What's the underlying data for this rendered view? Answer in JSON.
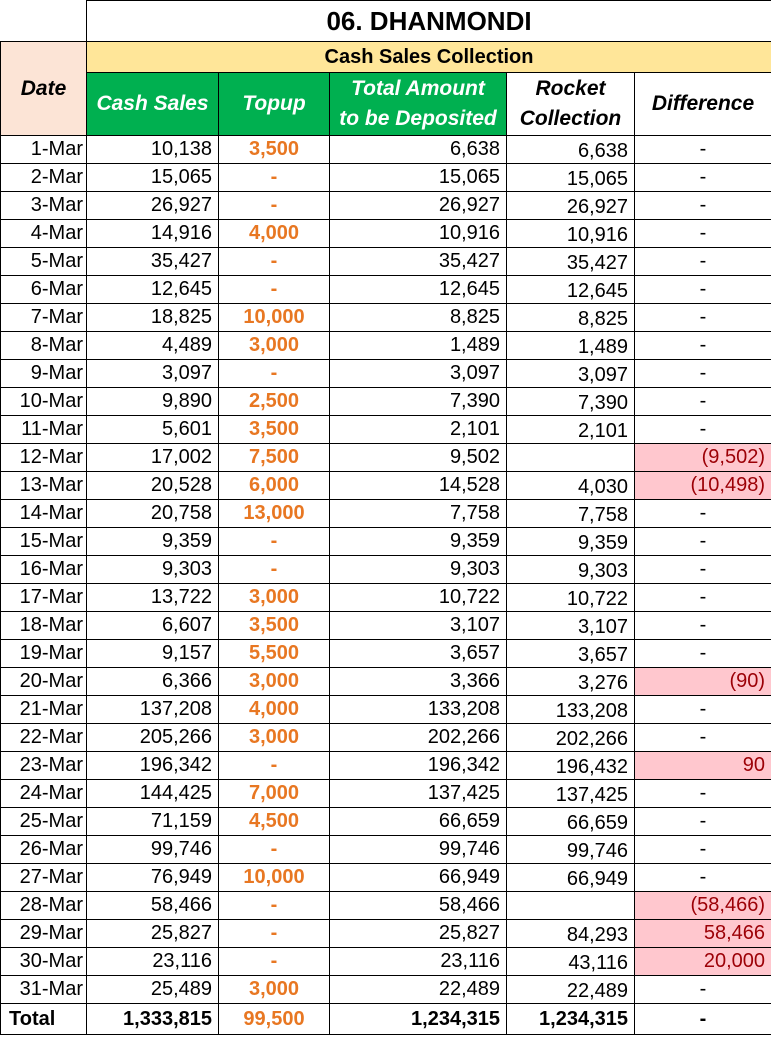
{
  "title": "06. DHANMONDI",
  "subheader": "Cash Sales Collection",
  "headers": {
    "date": "Date",
    "cash_sales": "Cash Sales",
    "topup": "Topup",
    "total_line1": "Total Amount",
    "total_line2": "to be Deposited",
    "rocket_line1": "Rocket",
    "rocket_line2": "Collection",
    "difference": "Difference"
  },
  "rows": [
    {
      "date": "1-Mar",
      "cash": "10,138",
      "topup": "3,500",
      "total": "6,638",
      "rocket": "6,638",
      "diff": "-",
      "flag": false
    },
    {
      "date": "2-Mar",
      "cash": "15,065",
      "topup": "-",
      "total": "15,065",
      "rocket": "15,065",
      "diff": "-",
      "flag": false
    },
    {
      "date": "3-Mar",
      "cash": "26,927",
      "topup": "-",
      "total": "26,927",
      "rocket": "26,927",
      "diff": "-",
      "flag": false
    },
    {
      "date": "4-Mar",
      "cash": "14,916",
      "topup": "4,000",
      "total": "10,916",
      "rocket": "10,916",
      "diff": "-",
      "flag": false
    },
    {
      "date": "5-Mar",
      "cash": "35,427",
      "topup": "-",
      "total": "35,427",
      "rocket": "35,427",
      "diff": "-",
      "flag": false
    },
    {
      "date": "6-Mar",
      "cash": "12,645",
      "topup": "-",
      "total": "12,645",
      "rocket": "12,645",
      "diff": "-",
      "flag": false
    },
    {
      "date": "7-Mar",
      "cash": "18,825",
      "topup": "10,000",
      "total": "8,825",
      "rocket": "8,825",
      "diff": "-",
      "flag": false
    },
    {
      "date": "8-Mar",
      "cash": "4,489",
      "topup": "3,000",
      "total": "1,489",
      "rocket": "1,489",
      "diff": "-",
      "flag": false
    },
    {
      "date": "9-Mar",
      "cash": "3,097",
      "topup": "-",
      "total": "3,097",
      "rocket": "3,097",
      "diff": "-",
      "flag": false
    },
    {
      "date": "10-Mar",
      "cash": "9,890",
      "topup": "2,500",
      "total": "7,390",
      "rocket": "7,390",
      "diff": "-",
      "flag": false
    },
    {
      "date": "11-Mar",
      "cash": "5,601",
      "topup": "3,500",
      "total": "2,101",
      "rocket": "2,101",
      "diff": "-",
      "flag": false
    },
    {
      "date": "12-Mar",
      "cash": "17,002",
      "topup": "7,500",
      "total": "9,502",
      "rocket": "",
      "diff": "(9,502)",
      "flag": true
    },
    {
      "date": "13-Mar",
      "cash": "20,528",
      "topup": "6,000",
      "total": "14,528",
      "rocket": "4,030",
      "diff": "(10,498)",
      "flag": true
    },
    {
      "date": "14-Mar",
      "cash": "20,758",
      "topup": "13,000",
      "total": "7,758",
      "rocket": "7,758",
      "diff": "-",
      "flag": false
    },
    {
      "date": "15-Mar",
      "cash": "9,359",
      "topup": "-",
      "total": "9,359",
      "rocket": "9,359",
      "diff": "-",
      "flag": false
    },
    {
      "date": "16-Mar",
      "cash": "9,303",
      "topup": "-",
      "total": "9,303",
      "rocket": "9,303",
      "diff": "-",
      "flag": false
    },
    {
      "date": "17-Mar",
      "cash": "13,722",
      "topup": "3,000",
      "total": "10,722",
      "rocket": "10,722",
      "diff": "-",
      "flag": false
    },
    {
      "date": "18-Mar",
      "cash": "6,607",
      "topup": "3,500",
      "total": "3,107",
      "rocket": "3,107",
      "diff": "-",
      "flag": false
    },
    {
      "date": "19-Mar",
      "cash": "9,157",
      "topup": "5,500",
      "total": "3,657",
      "rocket": "3,657",
      "diff": "-",
      "flag": false
    },
    {
      "date": "20-Mar",
      "cash": "6,366",
      "topup": "3,000",
      "total": "3,366",
      "rocket": "3,276",
      "diff": "(90)",
      "flag": true
    },
    {
      "date": "21-Mar",
      "cash": "137,208",
      "topup": "4,000",
      "total": "133,208",
      "rocket": "133,208",
      "diff": "-",
      "flag": false
    },
    {
      "date": "22-Mar",
      "cash": "205,266",
      "topup": "3,000",
      "total": "202,266",
      "rocket": "202,266",
      "diff": "-",
      "flag": false
    },
    {
      "date": "23-Mar",
      "cash": "196,342",
      "topup": "-",
      "total": "196,342",
      "rocket": "196,432",
      "diff": "90",
      "flag": true
    },
    {
      "date": "24-Mar",
      "cash": "144,425",
      "topup": "7,000",
      "total": "137,425",
      "rocket": "137,425",
      "diff": "-",
      "flag": false
    },
    {
      "date": "25-Mar",
      "cash": "71,159",
      "topup": "4,500",
      "total": "66,659",
      "rocket": "66,659",
      "diff": "-",
      "flag": false
    },
    {
      "date": "26-Mar",
      "cash": "99,746",
      "topup": "-",
      "total": "99,746",
      "rocket": "99,746",
      "diff": "-",
      "flag": false
    },
    {
      "date": "27-Mar",
      "cash": "76,949",
      "topup": "10,000",
      "total": "66,949",
      "rocket": "66,949",
      "diff": "-",
      "flag": false
    },
    {
      "date": "28-Mar",
      "cash": "58,466",
      "topup": "-",
      "total": "58,466",
      "rocket": "",
      "diff": "(58,466)",
      "flag": true
    },
    {
      "date": "29-Mar",
      "cash": "25,827",
      "topup": "-",
      "total": "25,827",
      "rocket": "84,293",
      "diff": "58,466",
      "flag": true
    },
    {
      "date": "30-Mar",
      "cash": "23,116",
      "topup": "-",
      "total": "23,116",
      "rocket": "43,116",
      "diff": "20,000",
      "flag": true
    },
    {
      "date": "31-Mar",
      "cash": "25,489",
      "topup": "3,000",
      "total": "22,489",
      "rocket": "22,489",
      "diff": "-",
      "flag": false
    }
  ],
  "totals": {
    "label": "Total",
    "cash": "1,333,815",
    "topup": "99,500",
    "total": "1,234,315",
    "rocket": "1,234,315",
    "diff": "-"
  },
  "colors": {
    "green_header": "#00B050",
    "yellow_subheader": "#FFE699",
    "date_header": "#FCE4D6",
    "topup_text": "#E87722",
    "diff_flag_fill": "#FFC7CE",
    "diff_flag_text": "#9C0006"
  }
}
